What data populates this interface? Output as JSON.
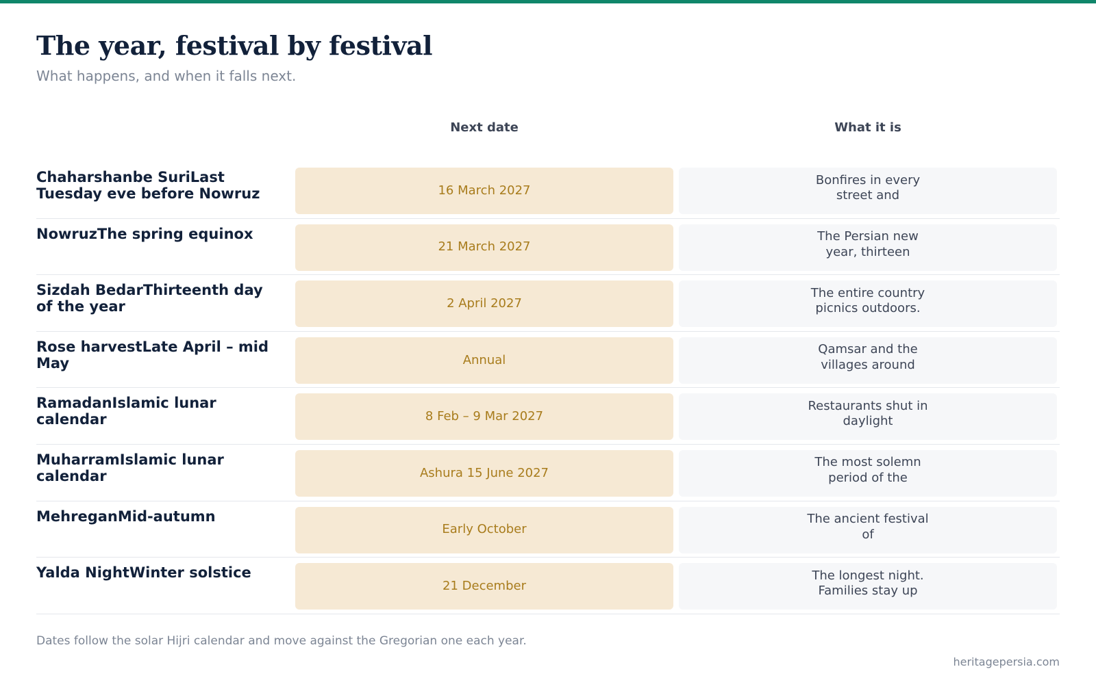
{
  "header": {
    "title": "The year, festival by festival",
    "subtitle": "What happens, and when it falls next."
  },
  "columns": {
    "date": "Next date",
    "what": "What it is"
  },
  "festivals": [
    {
      "name": "Chaharshanbe SuriLast Tuesday eve before Nowruz",
      "date": "16 March 2027",
      "what": "Bonfires in every street and"
    },
    {
      "name": "NowruzThe spring equinox",
      "date": "21 March 2027",
      "what": "The Persian new year, thirteen"
    },
    {
      "name": "Sizdah BedarThirteenth day of the year",
      "date": "2 April 2027",
      "what": "The entire country picnics outdoors."
    },
    {
      "name": "Rose harvestLate April – mid May",
      "date": "Annual",
      "what": "Qamsar and the villages around"
    },
    {
      "name": "RamadanIslamic lunar calendar",
      "date": "8 Feb – 9 Mar 2027",
      "what": "Restaurants shut in daylight"
    },
    {
      "name": "MuharramIslamic lunar calendar",
      "date": "Ashura 15 June 2027",
      "what": "The most solemn period of the"
    },
    {
      "name": "MehreganMid-autumn",
      "date": "Early October",
      "what": "The ancient festival of"
    },
    {
      "name": "Yalda NightWinter solstice",
      "date": "21 December",
      "what": "The longest night. Families stay up"
    }
  ],
  "footer": {
    "note": "Dates follow the solar Hijri calendar and move against the Gregorian one each year.",
    "source": "heritagepersia.com"
  },
  "colors": {
    "accent": "#10866a",
    "title": "#12213a",
    "date_bg": "#f6e9d4",
    "date_text": "#a87c1c",
    "what_bg": "#f6f7f9"
  }
}
